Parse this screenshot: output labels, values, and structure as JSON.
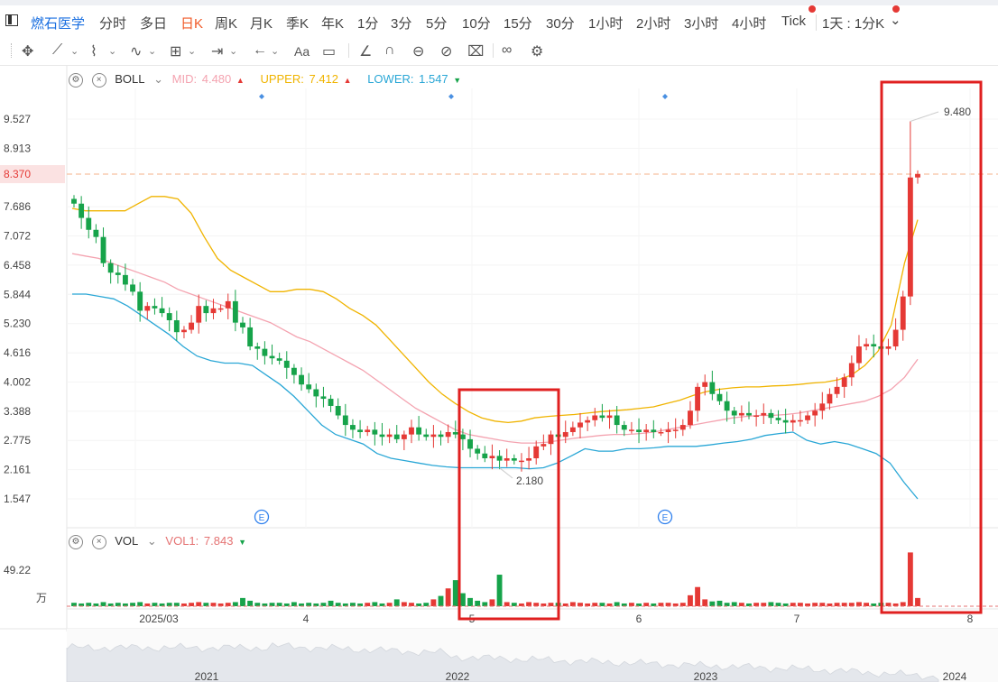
{
  "header": {
    "stock_name": "燃石医学",
    "periods": [
      "分时",
      "多日",
      "日K",
      "周K",
      "月K",
      "季K",
      "年K",
      "1分",
      "3分",
      "5分",
      "10分",
      "15分",
      "30分",
      "1小时",
      "2小时",
      "3小时",
      "4小时",
      "Tick",
      "1天 : 1分K"
    ],
    "active_period": "日K",
    "dropdown_caret": "⌄"
  },
  "toolbar": {
    "icons": [
      "move-icon",
      "line-tool-icon",
      "polyline-tool-icon",
      "wave-tool-icon",
      "measure-tool-icon",
      "range-tool-icon",
      "arrow-tool-icon",
      "text-tool-icon",
      "note-tool-icon",
      "angle-tool-icon",
      "magnet-icon",
      "lock-icon",
      "hide-icon",
      "delete-icon",
      "link-icon",
      "settings-icon"
    ],
    "text_tool_label": "Aa"
  },
  "boll_legend": {
    "name": "BOLL",
    "mid_label": "MID:",
    "mid_value": "4.480",
    "upper_label": "UPPER:",
    "upper_value": "7.412",
    "lower_label": "LOWER:",
    "lower_value": "1.547",
    "colors": {
      "mid": "#f4a3b0",
      "upper": "#f0b400",
      "lower": "#2aa7d6"
    }
  },
  "vol_legend": {
    "name": "VOL",
    "vol1_label": "VOL1:",
    "vol1_value": "7.843"
  },
  "colors": {
    "up": "#e53935",
    "down": "#16a34a",
    "highlight_box": "#e02020",
    "current_price_bg": "#fbe2e2",
    "dashed_price": "#f6b28a"
  },
  "chart_data": {
    "type": "candlestick",
    "y_ticks": [
      "9.527",
      "8.913",
      "8.370",
      "7.686",
      "7.072",
      "6.458",
      "5.844",
      "5.230",
      "4.616",
      "4.002",
      "3.388",
      "2.775",
      "2.161",
      "1.547"
    ],
    "current_price": "8.370",
    "y_range": [
      1.547,
      9.527
    ],
    "x_labels": [
      "2025/03",
      "4",
      "5",
      "6",
      "7",
      "8"
    ],
    "annotations": {
      "high_label": "9.480",
      "low_label": "2.180"
    },
    "close": [
      7.75,
      7.45,
      7.2,
      7.05,
      6.5,
      6.3,
      6.25,
      6.05,
      5.9,
      5.5,
      5.6,
      5.55,
      5.45,
      5.3,
      5.05,
      5.1,
      5.25,
      5.6,
      5.45,
      5.55,
      5.55,
      5.7,
      5.25,
      5.15,
      4.75,
      4.7,
      4.55,
      4.5,
      4.45,
      4.3,
      4.15,
      3.95,
      3.85,
      3.7,
      3.65,
      3.5,
      3.3,
      3.1,
      3.0,
      2.95,
      3.0,
      2.9,
      2.85,
      2.9,
      2.8,
      2.9,
      3.05,
      2.9,
      2.85,
      2.9,
      2.85,
      2.95,
      2.9,
      2.8,
      2.6,
      2.5,
      2.4,
      2.45,
      2.35,
      2.4,
      2.35,
      2.35,
      2.4,
      2.65,
      2.7,
      2.9,
      2.85,
      2.95,
      3.05,
      3.15,
      3.2,
      3.3,
      3.25,
      3.3,
      3.1,
      3.0,
      3.0,
      2.95,
      3.0,
      2.95,
      2.95,
      3.0,
      3.0,
      3.1,
      3.4,
      3.9,
      4.0,
      3.75,
      3.6,
      3.4,
      3.3,
      3.35,
      3.3,
      3.3,
      3.35,
      3.25,
      3.2,
      3.15,
      3.2,
      3.2,
      3.3,
      3.4,
      3.55,
      3.75,
      3.9,
      4.1,
      4.4,
      4.75,
      4.8,
      4.75,
      4.7,
      4.75,
      5.1,
      5.8,
      8.3,
      8.37
    ],
    "volume_wan": [
      0.5,
      0.4,
      0.5,
      0.4,
      0.6,
      0.4,
      0.5,
      0.4,
      0.5,
      0.6,
      0.4,
      0.5,
      0.4,
      0.5,
      0.5,
      0.4,
      0.5,
      0.6,
      0.5,
      0.5,
      0.4,
      0.5,
      0.6,
      1.2,
      0.8,
      0.5,
      0.4,
      0.5,
      0.5,
      0.4,
      0.6,
      0.4,
      0.5,
      0.4,
      0.5,
      0.8,
      0.5,
      0.4,
      0.5,
      0.4,
      0.5,
      0.6,
      0.4,
      0.5,
      1.0,
      0.6,
      0.5,
      0.4,
      0.5,
      1.0,
      1.5,
      2.6,
      3.8,
      1.9,
      1.2,
      0.8,
      0.6,
      1.0,
      4.6,
      0.6,
      0.5,
      0.4,
      0.6,
      0.5,
      0.4,
      0.5,
      0.5,
      0.4,
      0.6,
      0.5,
      0.4,
      0.5,
      0.5,
      0.4,
      0.6,
      0.4,
      0.5,
      0.4,
      0.5,
      0.4,
      0.5,
      0.5,
      0.4,
      0.5,
      1.6,
      2.8,
      1.0,
      0.7,
      0.8,
      0.5,
      0.6,
      0.5,
      0.4,
      0.5,
      0.5,
      0.6,
      0.5,
      0.4,
      0.5,
      0.5,
      0.4,
      0.5,
      0.5,
      0.4,
      0.5,
      0.5,
      0.5,
      0.6,
      0.5,
      0.4,
      0.5,
      0.5,
      0.4,
      0.6,
      7.843,
      1.2
    ],
    "boll_upper": [
      7.65,
      7.6,
      7.6,
      7.6,
      7.6,
      7.75,
      7.9,
      7.9,
      7.85,
      7.55,
      7.05,
      6.6,
      6.35,
      6.2,
      6.05,
      5.9,
      5.9,
      5.95,
      5.95,
      5.9,
      5.75,
      5.55,
      5.4,
      5.2,
      4.9,
      4.6,
      4.3,
      4.0,
      3.75,
      3.55,
      3.38,
      3.25,
      3.18,
      3.15,
      3.18,
      3.25,
      3.28,
      3.3,
      3.32,
      3.35,
      3.38,
      3.4,
      3.42,
      3.45,
      3.48,
      3.55,
      3.62,
      3.72,
      3.8,
      3.85,
      3.88,
      3.9,
      3.9,
      3.92,
      3.93,
      3.95,
      3.98,
      4.0,
      4.05,
      4.15,
      4.35,
      4.65,
      5.2,
      6.5,
      7.412
    ],
    "boll_mid": [
      6.7,
      6.65,
      6.6,
      6.5,
      6.4,
      6.3,
      6.2,
      6.1,
      5.95,
      5.85,
      5.75,
      5.65,
      5.55,
      5.45,
      5.35,
      5.25,
      5.1,
      4.95,
      4.85,
      4.7,
      4.55,
      4.4,
      4.25,
      4.05,
      3.85,
      3.65,
      3.45,
      3.3,
      3.15,
      3.0,
      2.9,
      2.85,
      2.8,
      2.75,
      2.72,
      2.72,
      2.74,
      2.78,
      2.82,
      2.85,
      2.88,
      2.9,
      2.9,
      2.92,
      2.95,
      3.0,
      3.05,
      3.1,
      3.15,
      3.2,
      3.25,
      3.28,
      3.3,
      3.3,
      3.32,
      3.35,
      3.4,
      3.45,
      3.5,
      3.55,
      3.6,
      3.7,
      3.85,
      4.1,
      4.48
    ],
    "boll_lower": [
      5.85,
      5.85,
      5.8,
      5.75,
      5.6,
      5.4,
      5.2,
      5.0,
      4.75,
      4.55,
      4.45,
      4.4,
      4.4,
      4.35,
      4.15,
      3.95,
      3.7,
      3.4,
      3.1,
      2.9,
      2.8,
      2.7,
      2.5,
      2.4,
      2.35,
      2.3,
      2.25,
      2.22,
      2.2,
      2.2,
      2.2,
      2.2,
      2.2,
      2.18,
      2.2,
      2.3,
      2.45,
      2.6,
      2.55,
      2.55,
      2.6,
      2.6,
      2.62,
      2.65,
      2.65,
      2.65,
      2.68,
      2.72,
      2.75,
      2.8,
      2.88,
      2.92,
      2.95,
      2.78,
      2.7,
      2.75,
      2.7,
      2.6,
      2.5,
      2.3,
      1.9,
      1.547
    ]
  },
  "overview": {
    "year_labels": [
      "2021",
      "2022",
      "2023",
      "2024"
    ]
  },
  "event_markers": [
    "E",
    "E"
  ]
}
